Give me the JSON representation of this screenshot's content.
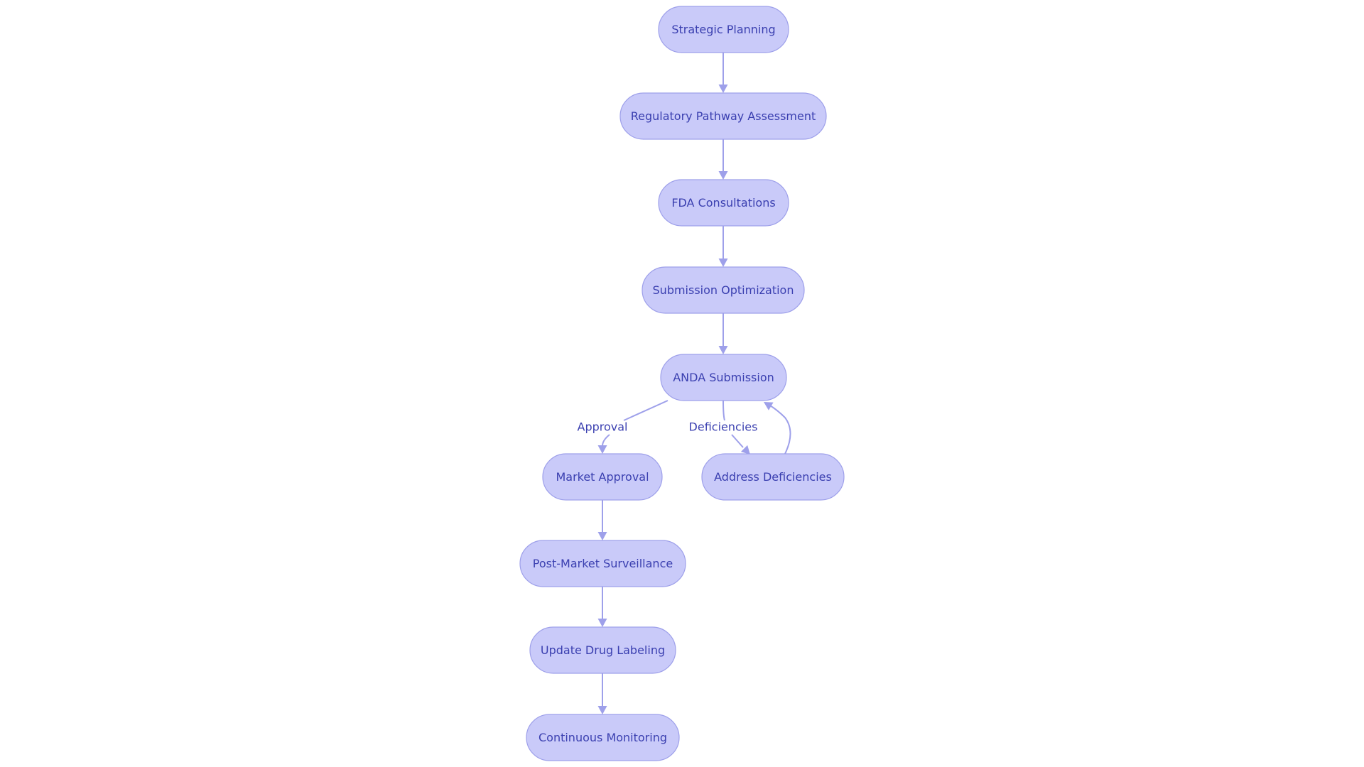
{
  "diagram": {
    "type": "flowchart",
    "direction": "top-down",
    "colors": {
      "node_fill": "#c9caf9",
      "node_stroke": "#9ea0ea",
      "text": "#3a3fb0",
      "edge": "#9ea0ea"
    },
    "nodes": [
      {
        "id": "strategic",
        "label": "Strategic Planning"
      },
      {
        "id": "regulatory",
        "label": "Regulatory Pathway Assessment"
      },
      {
        "id": "fda",
        "label": "FDA Consultations"
      },
      {
        "id": "submission_opt",
        "label": "Submission Optimization"
      },
      {
        "id": "anda",
        "label": "ANDA Submission"
      },
      {
        "id": "market",
        "label": "Market Approval"
      },
      {
        "id": "address",
        "label": "Address Deficiencies"
      },
      {
        "id": "postmarket",
        "label": "Post-Market Surveillance"
      },
      {
        "id": "labeling",
        "label": "Update Drug Labeling"
      },
      {
        "id": "monitoring",
        "label": "Continuous Monitoring"
      }
    ],
    "edges": [
      {
        "from": "strategic",
        "to": "regulatory",
        "label": ""
      },
      {
        "from": "regulatory",
        "to": "fda",
        "label": ""
      },
      {
        "from": "fda",
        "to": "submission_opt",
        "label": ""
      },
      {
        "from": "submission_opt",
        "to": "anda",
        "label": ""
      },
      {
        "from": "anda",
        "to": "market",
        "label": "Approval"
      },
      {
        "from": "anda",
        "to": "address",
        "label": "Deficiencies"
      },
      {
        "from": "address",
        "to": "anda",
        "label": ""
      },
      {
        "from": "market",
        "to": "postmarket",
        "label": ""
      },
      {
        "from": "postmarket",
        "to": "labeling",
        "label": ""
      },
      {
        "from": "labeling",
        "to": "monitoring",
        "label": ""
      }
    ]
  }
}
